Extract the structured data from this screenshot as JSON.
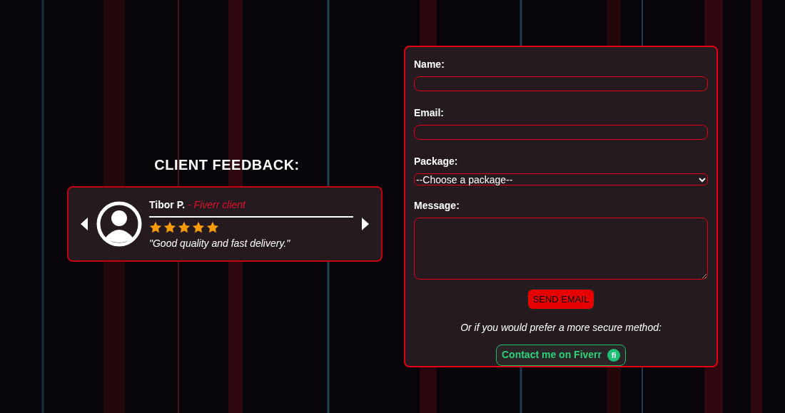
{
  "feedback": {
    "heading": "CLIENT FEEDBACK:",
    "review": {
      "name": "Tibor P.",
      "role": "- Fiverr client",
      "stars": 5,
      "quote": "\"Good quality and fast delivery.\""
    }
  },
  "form": {
    "fields": [
      {
        "kind": "text",
        "label": "Name:"
      },
      {
        "kind": "text",
        "label": "Email:"
      },
      {
        "kind": "select",
        "label": "Package:",
        "value": "--Choose a package--"
      },
      {
        "kind": "textarea",
        "label": "Message:"
      }
    ],
    "submit": "SEND EMAIL",
    "note": "Or if you would prefer a more secure method:",
    "fiverr_button": {
      "label": "Contact me on Fiverr",
      "badge": "fi"
    }
  }
}
